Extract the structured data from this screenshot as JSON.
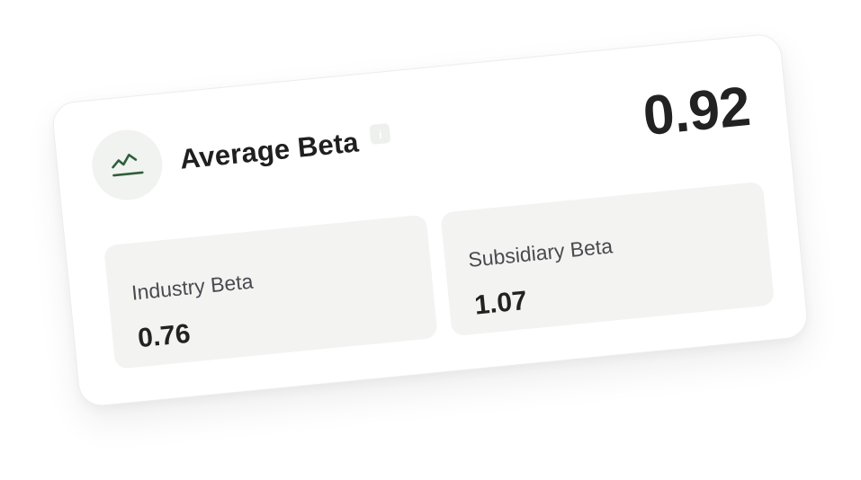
{
  "card": {
    "title": "Average Beta",
    "value": "0.92",
    "icon": "trend-line-icon",
    "info_icon": "info-icon",
    "accent_color": "#2f5e3a"
  },
  "metrics": [
    {
      "label": "Industry Beta",
      "value": "0.76"
    },
    {
      "label": "Subsidiary Beta",
      "value": "1.07"
    }
  ]
}
